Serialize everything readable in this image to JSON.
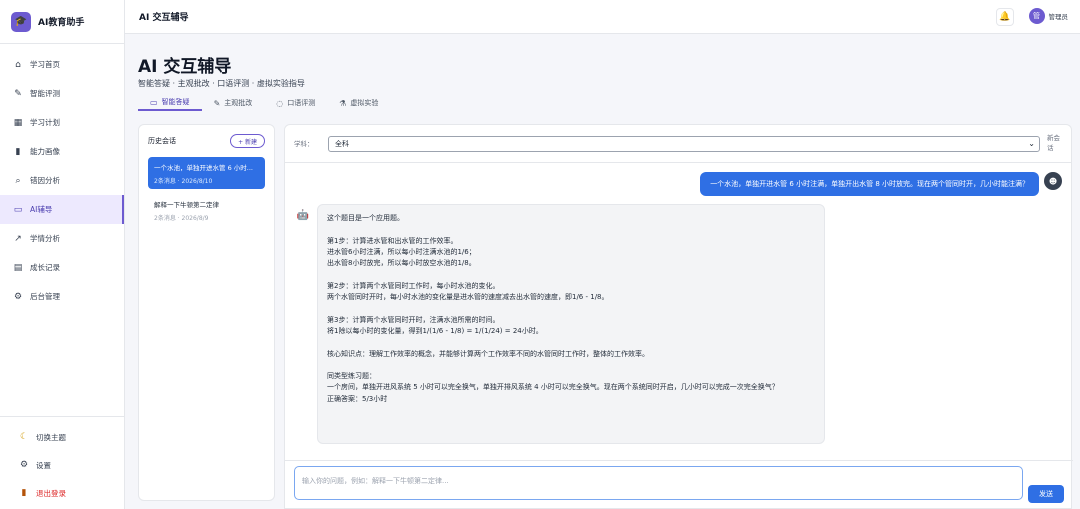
{
  "app": {
    "brand": "AI教育助手",
    "logo_icon": "🎓"
  },
  "topbar": {
    "title": "AI 交互辅导",
    "user_name": "管理员",
    "avatar_text": "管"
  },
  "sidebar": {
    "items": [
      {
        "icon": "home-icon",
        "glyph": "⌂",
        "label": "学习首页"
      },
      {
        "icon": "edit-doc-icon",
        "glyph": "✎",
        "label": "智能评测"
      },
      {
        "icon": "calendar-icon",
        "glyph": "▦",
        "label": "学习计划"
      },
      {
        "icon": "bar-chart-icon",
        "glyph": "▮",
        "label": "能力画像"
      },
      {
        "icon": "magnifier-icon",
        "glyph": "⌕",
        "label": "错因分析"
      },
      {
        "icon": "chat-icon",
        "glyph": "▭",
        "label": "AI辅导",
        "active": true
      },
      {
        "icon": "trend-icon",
        "glyph": "↗",
        "label": "学情分析"
      },
      {
        "icon": "notebook-icon",
        "glyph": "▤",
        "label": "成长记录"
      },
      {
        "icon": "gear-icon",
        "glyph": "⚙",
        "label": "后台管理"
      }
    ],
    "bottom": {
      "theme": "切换主题",
      "settings": "设置",
      "logout": "退出登录"
    }
  },
  "page": {
    "title": "AI 交互辅导",
    "subtitle": "智能答疑 · 主观批改 · 口语评测 · 虚拟实验指导",
    "tabs": [
      {
        "icon": "chat-bubble-icon",
        "glyph": "▭",
        "label": "智能答疑",
        "active": true
      },
      {
        "icon": "pencil-note-icon",
        "glyph": "✎",
        "label": "主观批改"
      },
      {
        "icon": "speech-icon",
        "glyph": "◌",
        "label": "口语评测"
      },
      {
        "icon": "flask-icon",
        "glyph": "⚗",
        "label": "虚拟实验"
      }
    ]
  },
  "history": {
    "title": "历史会话",
    "new_button": "+ 新建",
    "sessions": [
      {
        "title": "一个水池，单独开进水管 6 小时...",
        "meta": "2条消息 · 2026/8/10",
        "active": true
      },
      {
        "title": "解释一下牛顿第二定律",
        "meta": "2条消息 · 2026/8/9",
        "active": false
      }
    ]
  },
  "chat": {
    "subject_label": "学科：",
    "subject_value": "全科",
    "new_chat_label": "新会话",
    "user_message": "一个水池，单独开进水管 6 小时注满，单独开出水管 8 小时放完。现在两个管同时开，几小时能注满？",
    "bot_lines": [
      "这个题目是一个应用题。",
      "",
      "第1步：计算进水管和出水管的工作效率。",
      "进水管6小时注满，所以每小时注满水池的1/6；",
      "出水管8小时放完，所以每小时放空水池的1/8。",
      "",
      "第2步：计算两个水管同时工作时，每小时水池的变化。",
      "两个水管同时开时，每小时水池的变化量是进水管的速度减去出水管的速度，即1/6 - 1/8。",
      "",
      "第3步：计算两个水管同时开时，注满水池所需的时间。",
      "将1除以每小时的变化量，得到1/(1/6 - 1/8) = 1/(1/24) = 24小时。",
      "",
      "核心知识点：理解工作效率的概念，并能够计算两个工作效率不同的水管同时工作时，整体的工作效率。",
      "",
      "同类型练习题：",
      "一个房间，单独开进风系统 5 小时可以完全换气，单独开排风系统 4 小时可以完全换气。现在两个系统同时开启，几小时可以完成一次完全换气？",
      "正确答案：5/3小时"
    ],
    "input_placeholder": "输入你的问题，例如：解释一下牛顿第二定律...",
    "send_label": "发送"
  },
  "colors": {
    "accent": "#6d5bd0",
    "primary_blue": "#2f6fe4"
  }
}
